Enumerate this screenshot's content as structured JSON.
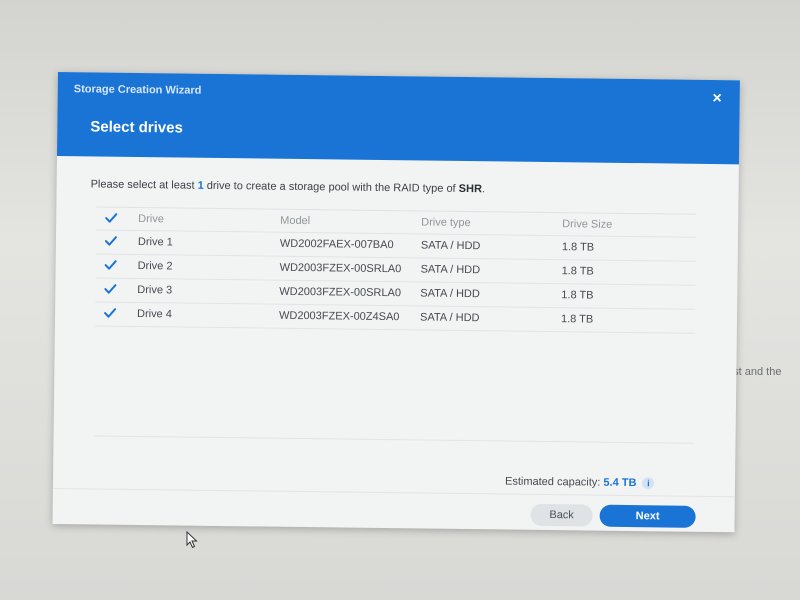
{
  "background": {
    "partial_text": "first and the"
  },
  "dialog": {
    "wizard_title": "Storage Creation Wizard",
    "close_glyph": "×",
    "step_title": "Select drives",
    "instruction": {
      "pre": "Please select at least ",
      "count": "1",
      "mid": " drive to create a storage pool with the RAID type of ",
      "raid": "SHR",
      "post": "."
    },
    "table": {
      "headers": {
        "drive": "Drive",
        "model": "Model",
        "type": "Drive type",
        "size": "Drive Size"
      },
      "rows": [
        {
          "drive": "Drive 1",
          "model": "WD2002FAEX-007BA0",
          "type": "SATA / HDD",
          "size": "1.8 TB",
          "checked": true
        },
        {
          "drive": "Drive 2",
          "model": "WD2003FZEX-00SRLA0",
          "type": "SATA / HDD",
          "size": "1.8 TB",
          "checked": true
        },
        {
          "drive": "Drive 3",
          "model": "WD2003FZEX-00SRLA0",
          "type": "SATA / HDD",
          "size": "1.8 TB",
          "checked": true
        },
        {
          "drive": "Drive 4",
          "model": "WD2003FZEX-00Z4SA0",
          "type": "SATA / HDD",
          "size": "1.8 TB",
          "checked": true
        }
      ]
    },
    "capacity": {
      "label": "Estimated capacity: ",
      "value": "5.4 TB",
      "info_glyph": "i"
    },
    "buttons": {
      "back": "Back",
      "next": "Next"
    }
  },
  "colors": {
    "accent": "#1a74d6",
    "header_bg": "#1a74d6",
    "button_secondary": "#e0e3e6"
  },
  "icons": {
    "close": "close-icon",
    "check": "checkmark-icon",
    "info": "info-icon",
    "cursor": "mouse-pointer-icon"
  }
}
